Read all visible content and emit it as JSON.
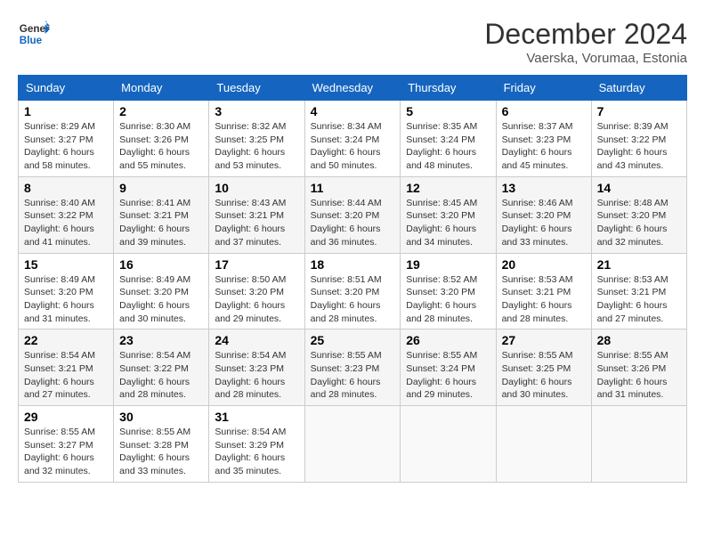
{
  "logo": {
    "line1": "General",
    "line2": "Blue"
  },
  "title": "December 2024",
  "subtitle": "Vaerska, Vorumaa, Estonia",
  "days_of_week": [
    "Sunday",
    "Monday",
    "Tuesday",
    "Wednesday",
    "Thursday",
    "Friday",
    "Saturday"
  ],
  "weeks": [
    [
      {
        "day": "1",
        "info": "Sunrise: 8:29 AM\nSunset: 3:27 PM\nDaylight: 6 hours and 58 minutes."
      },
      {
        "day": "2",
        "info": "Sunrise: 8:30 AM\nSunset: 3:26 PM\nDaylight: 6 hours and 55 minutes."
      },
      {
        "day": "3",
        "info": "Sunrise: 8:32 AM\nSunset: 3:25 PM\nDaylight: 6 hours and 53 minutes."
      },
      {
        "day": "4",
        "info": "Sunrise: 8:34 AM\nSunset: 3:24 PM\nDaylight: 6 hours and 50 minutes."
      },
      {
        "day": "5",
        "info": "Sunrise: 8:35 AM\nSunset: 3:24 PM\nDaylight: 6 hours and 48 minutes."
      },
      {
        "day": "6",
        "info": "Sunrise: 8:37 AM\nSunset: 3:23 PM\nDaylight: 6 hours and 45 minutes."
      },
      {
        "day": "7",
        "info": "Sunrise: 8:39 AM\nSunset: 3:22 PM\nDaylight: 6 hours and 43 minutes."
      }
    ],
    [
      {
        "day": "8",
        "info": "Sunrise: 8:40 AM\nSunset: 3:22 PM\nDaylight: 6 hours and 41 minutes."
      },
      {
        "day": "9",
        "info": "Sunrise: 8:41 AM\nSunset: 3:21 PM\nDaylight: 6 hours and 39 minutes."
      },
      {
        "day": "10",
        "info": "Sunrise: 8:43 AM\nSunset: 3:21 PM\nDaylight: 6 hours and 37 minutes."
      },
      {
        "day": "11",
        "info": "Sunrise: 8:44 AM\nSunset: 3:20 PM\nDaylight: 6 hours and 36 minutes."
      },
      {
        "day": "12",
        "info": "Sunrise: 8:45 AM\nSunset: 3:20 PM\nDaylight: 6 hours and 34 minutes."
      },
      {
        "day": "13",
        "info": "Sunrise: 8:46 AM\nSunset: 3:20 PM\nDaylight: 6 hours and 33 minutes."
      },
      {
        "day": "14",
        "info": "Sunrise: 8:48 AM\nSunset: 3:20 PM\nDaylight: 6 hours and 32 minutes."
      }
    ],
    [
      {
        "day": "15",
        "info": "Sunrise: 8:49 AM\nSunset: 3:20 PM\nDaylight: 6 hours and 31 minutes."
      },
      {
        "day": "16",
        "info": "Sunrise: 8:49 AM\nSunset: 3:20 PM\nDaylight: 6 hours and 30 minutes."
      },
      {
        "day": "17",
        "info": "Sunrise: 8:50 AM\nSunset: 3:20 PM\nDaylight: 6 hours and 29 minutes."
      },
      {
        "day": "18",
        "info": "Sunrise: 8:51 AM\nSunset: 3:20 PM\nDaylight: 6 hours and 28 minutes."
      },
      {
        "day": "19",
        "info": "Sunrise: 8:52 AM\nSunset: 3:20 PM\nDaylight: 6 hours and 28 minutes."
      },
      {
        "day": "20",
        "info": "Sunrise: 8:53 AM\nSunset: 3:21 PM\nDaylight: 6 hours and 28 minutes."
      },
      {
        "day": "21",
        "info": "Sunrise: 8:53 AM\nSunset: 3:21 PM\nDaylight: 6 hours and 27 minutes."
      }
    ],
    [
      {
        "day": "22",
        "info": "Sunrise: 8:54 AM\nSunset: 3:21 PM\nDaylight: 6 hours and 27 minutes."
      },
      {
        "day": "23",
        "info": "Sunrise: 8:54 AM\nSunset: 3:22 PM\nDaylight: 6 hours and 28 minutes."
      },
      {
        "day": "24",
        "info": "Sunrise: 8:54 AM\nSunset: 3:23 PM\nDaylight: 6 hours and 28 minutes."
      },
      {
        "day": "25",
        "info": "Sunrise: 8:55 AM\nSunset: 3:23 PM\nDaylight: 6 hours and 28 minutes."
      },
      {
        "day": "26",
        "info": "Sunrise: 8:55 AM\nSunset: 3:24 PM\nDaylight: 6 hours and 29 minutes."
      },
      {
        "day": "27",
        "info": "Sunrise: 8:55 AM\nSunset: 3:25 PM\nDaylight: 6 hours and 30 minutes."
      },
      {
        "day": "28",
        "info": "Sunrise: 8:55 AM\nSunset: 3:26 PM\nDaylight: 6 hours and 31 minutes."
      }
    ],
    [
      {
        "day": "29",
        "info": "Sunrise: 8:55 AM\nSunset: 3:27 PM\nDaylight: 6 hours and 32 minutes."
      },
      {
        "day": "30",
        "info": "Sunrise: 8:55 AM\nSunset: 3:28 PM\nDaylight: 6 hours and 33 minutes."
      },
      {
        "day": "31",
        "info": "Sunrise: 8:54 AM\nSunset: 3:29 PM\nDaylight: 6 hours and 35 minutes."
      },
      null,
      null,
      null,
      null
    ]
  ]
}
